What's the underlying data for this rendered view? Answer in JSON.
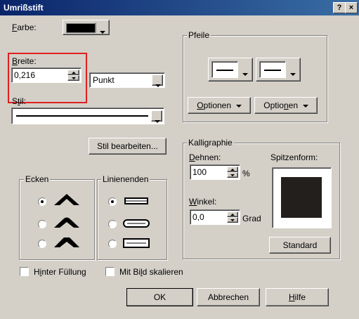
{
  "window": {
    "title": "Umrißstift",
    "help_button": "?",
    "close_button": "×"
  },
  "color": {
    "label": "Farbe:",
    "swatch": "#000000"
  },
  "width": {
    "label": "Breite:",
    "value": "0,216",
    "unit": "Punkt",
    "highlight": "#e02020"
  },
  "style": {
    "label": "Stil:",
    "edit_button": "Stil bearbeiten..."
  },
  "arrows": {
    "group_label": "Pfeile",
    "options_left": "Optionen",
    "options_right": "Optionen"
  },
  "corners": {
    "group_label": "Ecken",
    "selected": 0
  },
  "line_ends": {
    "group_label": "Linienenden",
    "selected": 0
  },
  "calligraphy": {
    "group_label": "Kalligraphie",
    "stretch_label": "Dehnen:",
    "stretch_value": "100",
    "stretch_unit": "%",
    "angle_label": "Winkel:",
    "angle_value": "0,0",
    "angle_unit": "Grad",
    "nib_label": "Spitzenform:",
    "nib_color": "#231f1c",
    "default_button": "Standard"
  },
  "options": {
    "behind_fill": "Hinter Füllung",
    "scale_with_image": "Mit Bild skalieren"
  },
  "footer": {
    "ok": "OK",
    "cancel": "Abbrechen",
    "help": "Hilfe"
  }
}
